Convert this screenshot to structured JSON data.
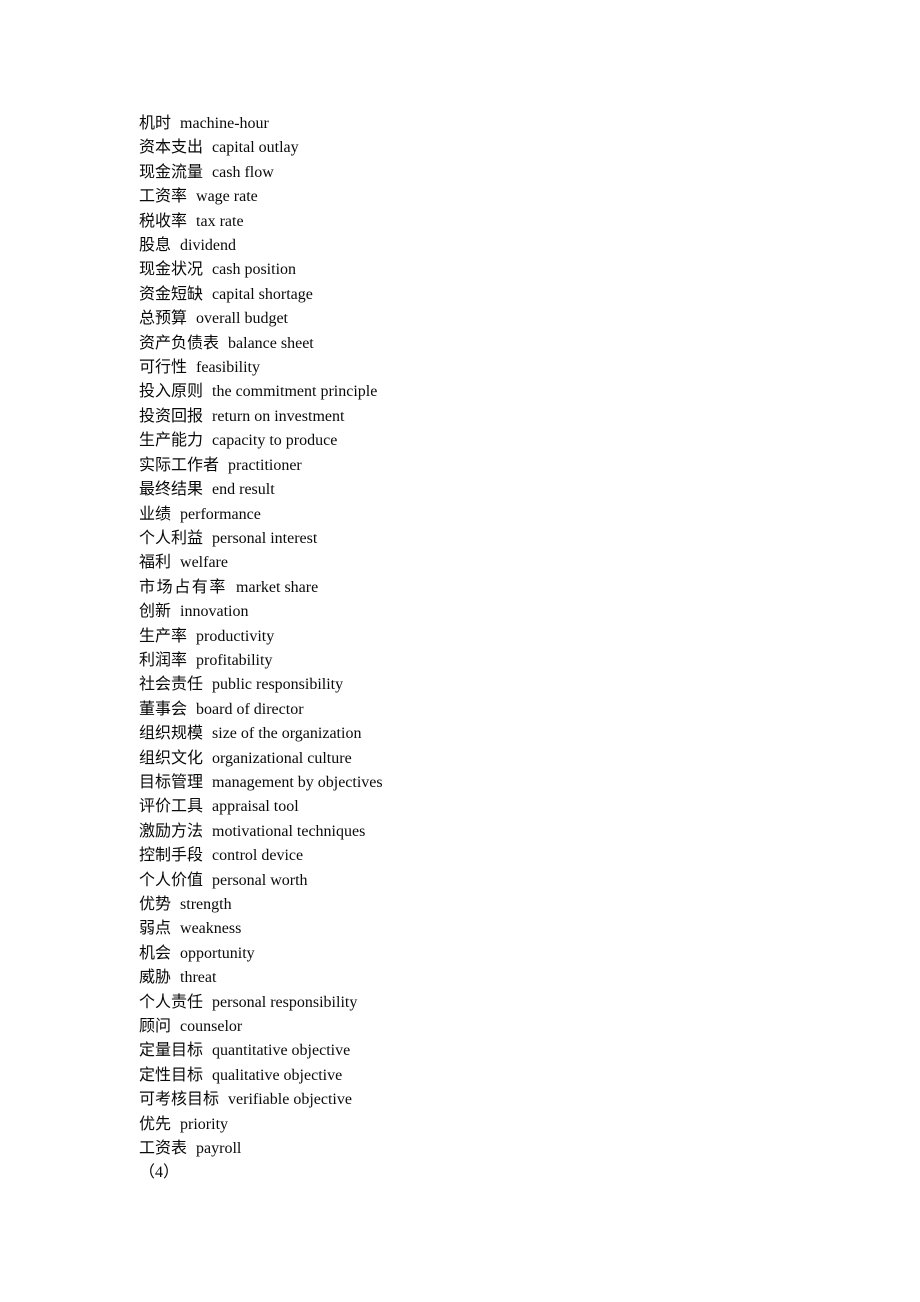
{
  "document": {
    "type": "bilingual-glossary",
    "language_pair": "Chinese-English",
    "text_color": "#0a0a0a",
    "background_color": "#ffffff"
  },
  "entries": [
    {
      "term": "机时",
      "gloss": "machine-hour",
      "loose": false
    },
    {
      "term": "资本支出",
      "gloss": "capital outlay",
      "loose": false
    },
    {
      "term": "现金流量",
      "gloss": "cash flow",
      "loose": false
    },
    {
      "term": "工资率",
      "gloss": "wage rate",
      "loose": false
    },
    {
      "term": "税收率",
      "gloss": "tax rate",
      "loose": false
    },
    {
      "term": "股息",
      "gloss": "dividend",
      "loose": false
    },
    {
      "term": "现金状况",
      "gloss": "cash position",
      "loose": false
    },
    {
      "term": "资金短缺",
      "gloss": "capital shortage",
      "loose": false
    },
    {
      "term": "总预算",
      "gloss": "overall budget",
      "loose": false
    },
    {
      "term": "资产负债表",
      "gloss": "balance sheet",
      "loose": false
    },
    {
      "term": "可行性",
      "gloss": "feasibility",
      "loose": false
    },
    {
      "term": "投入原则",
      "gloss": "the commitment principle",
      "loose": false
    },
    {
      "term": "投资回报",
      "gloss": "return on investment",
      "loose": false
    },
    {
      "term": "生产能力",
      "gloss": "capacity to produce",
      "loose": false
    },
    {
      "term": "实际工作者",
      "gloss": "practitioner",
      "loose": false
    },
    {
      "term": "最终结果",
      "gloss": "end result",
      "loose": false
    },
    {
      "term": "业绩",
      "gloss": "performance",
      "loose": false
    },
    {
      "term": "个人利益",
      "gloss": "personal interest",
      "loose": false
    },
    {
      "term": "福利",
      "gloss": "welfare",
      "loose": false
    },
    {
      "term": "市场占有率",
      "gloss": "market share",
      "loose": true
    },
    {
      "term": "创新",
      "gloss": "innovation",
      "loose": false
    },
    {
      "term": "生产率",
      "gloss": "productivity",
      "loose": false
    },
    {
      "term": "利润率",
      "gloss": "profitability",
      "loose": false
    },
    {
      "term": "社会责任",
      "gloss": "public responsibility",
      "loose": false
    },
    {
      "term": "董事会",
      "gloss": "board of director",
      "loose": false
    },
    {
      "term": "组织规模",
      "gloss": "size of the organization",
      "loose": false
    },
    {
      "term": "组织文化",
      "gloss": "organizational culture",
      "loose": false
    },
    {
      "term": "目标管理",
      "gloss": "management by objectives",
      "loose": false
    },
    {
      "term": "评价工具",
      "gloss": "appraisal tool",
      "loose": false
    },
    {
      "term": "激励方法",
      "gloss": "motivational techniques",
      "loose": false
    },
    {
      "term": "控制手段",
      "gloss": "control device",
      "loose": false
    },
    {
      "term": "个人价值",
      "gloss": "personal worth",
      "loose": false
    },
    {
      "term": "优势",
      "gloss": "strength",
      "loose": false
    },
    {
      "term": "弱点",
      "gloss": "weakness",
      "loose": false
    },
    {
      "term": "机会",
      "gloss": "opportunity",
      "loose": false
    },
    {
      "term": "威胁",
      "gloss": "threat",
      "loose": false
    },
    {
      "term": "个人责任",
      "gloss": "personal responsibility",
      "loose": false
    },
    {
      "term": "顾问",
      "gloss": "counselor",
      "loose": false
    },
    {
      "term": "定量目标",
      "gloss": "quantitative objective",
      "loose": false
    },
    {
      "term": "定性目标",
      "gloss": "qualitative objective",
      "loose": false
    },
    {
      "term": "可考核目标",
      "gloss": "verifiable objective",
      "loose": false
    },
    {
      "term": "优先",
      "gloss": "priority",
      "loose": false
    },
    {
      "term": "工资表",
      "gloss": "payroll",
      "loose": false
    }
  ],
  "section_marker": "（4）"
}
